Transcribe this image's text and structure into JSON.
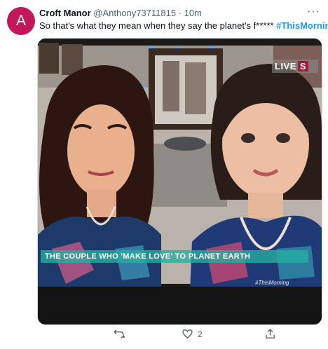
{
  "tweet": {
    "avatar_letter": "A",
    "name": "Croft Manor",
    "handle": "@Anthony73711815",
    "separator": "·",
    "time": "10m",
    "text": "So that's what they mean when they say the planet's f*****",
    "hashtag": "#ThisMorning",
    "more_label": "···"
  },
  "media": {
    "live_label": "LIVE",
    "live_suffix": "S",
    "banner_text": "THE COUPLE WHO 'MAKE LOVE' TO PLANET EARTH",
    "corner_tag": "#ThisMorning"
  },
  "actions": {
    "reply_icon": "reply-icon",
    "retweet_icon": "retweet-icon",
    "like_icon": "heart-icon",
    "like_count": "2",
    "share_icon": "share-icon"
  },
  "colors": {
    "avatar_bg": "#c2185b",
    "hashtag": "#1d9bf0",
    "banner": "#26afa0",
    "live_badge_accent": "#b0133a"
  }
}
